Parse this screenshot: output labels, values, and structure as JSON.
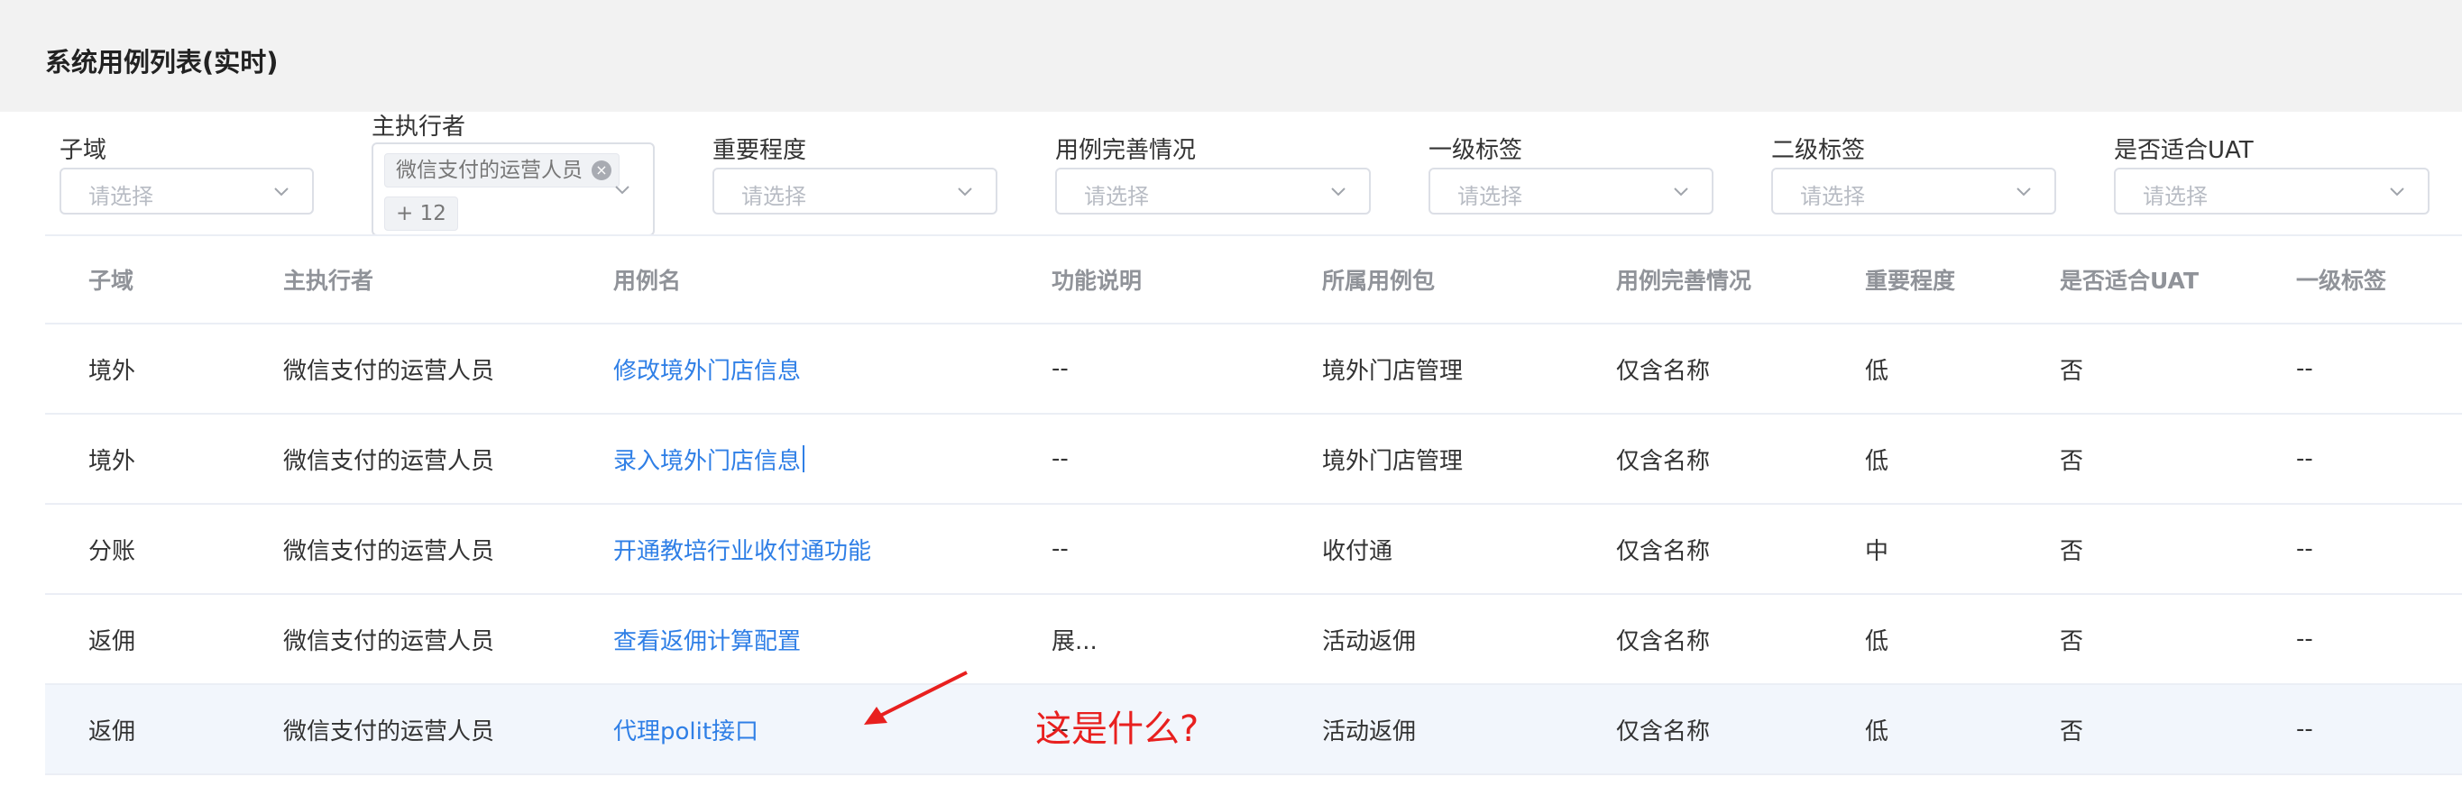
{
  "page": {
    "title": "系统用例列表(实时)"
  },
  "filters": {
    "subdomain": {
      "label": "子域",
      "placeholder": "请选择"
    },
    "executor": {
      "label": "主执行者",
      "tag": "微信支付的运营人员",
      "more": "+ 12"
    },
    "importance": {
      "label": "重要程度",
      "placeholder": "请选择"
    },
    "completeness": {
      "label": "用例完善情况",
      "placeholder": "请选择"
    },
    "tag1": {
      "label": "一级标签",
      "placeholder": "请选择"
    },
    "tag2": {
      "label": "二级标签",
      "placeholder": "请选择"
    },
    "uat": {
      "label": "是否适合UAT",
      "placeholder": "请选择"
    }
  },
  "table": {
    "columns": [
      "子域",
      "主执行者",
      "用例名",
      "功能说明",
      "所属用例包",
      "用例完善情况",
      "重要程度",
      "是否适合UAT",
      "一级标签"
    ],
    "rows": [
      [
        "境外",
        "微信支付的运营人员",
        "修改境外门店信息",
        "--",
        "境外门店管理",
        "仅含名称",
        "低",
        "否",
        "--"
      ],
      [
        "境外",
        "微信支付的运营人员",
        "录入境外门店信息",
        "--",
        "境外门店管理",
        "仅含名称",
        "低",
        "否",
        "--"
      ],
      [
        "分账",
        "微信支付的运营人员",
        "开通教培行业收付通功能",
        "--",
        "收付通",
        "仅含名称",
        "中",
        "否",
        "--"
      ],
      [
        "返佣",
        "微信支付的运营人员",
        "查看返佣计算配置",
        "展...",
        "活动返佣",
        "仅含名称",
        "低",
        "否",
        "--"
      ],
      [
        "返佣",
        "微信支付的运营人员",
        "代理polit接口",
        "--",
        "活动返佣",
        "仅含名称",
        "低",
        "否",
        "--"
      ]
    ]
  },
  "annotation": {
    "text": "这是什么?",
    "color": "#e8201f"
  },
  "colors": {
    "link": "#2f7fe6",
    "header_bg": "#f2f2f2",
    "row_highlight": "#f2f6fc"
  }
}
